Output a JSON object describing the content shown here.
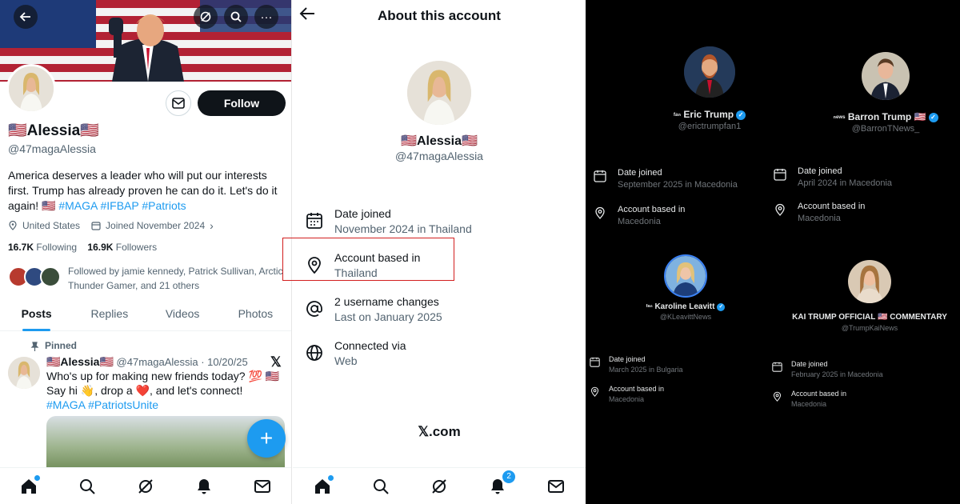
{
  "colors": {
    "accent": "#1d9bf0",
    "highlight": "#d21e1e",
    "dark_bg": "#000000"
  },
  "profile": {
    "name": "🇺🇸Alessia🇺🇸",
    "handle": "@47magaAlessia",
    "follow_label": "Follow",
    "bio_text": "America deserves a leader who will put our interests first. Trump has already proven he can do it. Let's do it again! 🇺🇸",
    "bio_tags": "#MAGA #IFBAP #Patriots",
    "location": "United States",
    "joined": "Joined November 2024",
    "following_count": "16.7K",
    "following_label": "Following",
    "followers_count": "16.9K",
    "followers_label": "Followers",
    "followed_by": "Followed by jamie kennedy, Patrick Sullivan, Arctic Thunder Gamer, and 21 others",
    "tabs": [
      "Posts",
      "Replies",
      "Videos",
      "Photos"
    ]
  },
  "pinned_post": {
    "pinned_label": "Pinned",
    "author": "🇺🇸Alessia🇺🇸",
    "handle_date": "@47magaAlessia · 10/20/25",
    "text": "Who's up for making new friends today? 💯 🇺🇸 Say hi 👋, drop a ❤️, and let's connect!",
    "tags": "#MAGA #PatriotsUnite"
  },
  "nav": {
    "icons": [
      "home-icon",
      "search-icon",
      "grok-icon",
      "notifications-icon",
      "messages-icon"
    ],
    "notification_badge": "2"
  },
  "about": {
    "title": "About this account",
    "name": "🇺🇸Alessia🇺🇸",
    "handle": "@47magaAlessia",
    "rows": [
      {
        "icon": "calendar-icon",
        "label": "Date joined",
        "value": "November 2024 in Thailand"
      },
      {
        "icon": "location-icon",
        "label": "Account based in",
        "value": "Thailand"
      },
      {
        "icon": "at-icon",
        "label": "2 username changes",
        "value": "Last on January 2025"
      },
      {
        "icon": "globe-icon",
        "label": "Connected via",
        "value": "Web"
      }
    ],
    "footer": "𝕏.com"
  },
  "accounts": [
    {
      "prefix": "ᶠᵃⁿ",
      "name": "Eric Trump",
      "flag": "",
      "verified": true,
      "handle": "@erictrumpfan1",
      "joined_label": "Date joined",
      "joined": "September 2025 in Macedonia",
      "based_label": "Account based in",
      "based": "Macedonia"
    },
    {
      "prefix": "ⁿᵉʷˢ",
      "name": "Barron Trump",
      "flag": "🇺🇸",
      "verified": true,
      "handle": "@BarronTNews_",
      "joined_label": "Date joined",
      "joined": "April 2024 in Macedonia",
      "based_label": "Account based in",
      "based": "Macedonia"
    },
    {
      "prefix": "ᶠᵃⁿ",
      "name": "Karoline Leavitt",
      "flag": "",
      "verified": true,
      "handle": "@KLeavittNews",
      "joined_label": "Date joined",
      "joined": "March 2025 in Bulgaria",
      "based_label": "Account based in",
      "based": "Macedonia"
    },
    {
      "prefix": "",
      "name": "KAI TRUMP OFFICIAL 🇺🇸 COMMENTARY",
      "flag": "",
      "verified": false,
      "handle": "@TrumpKaiNews",
      "joined_label": "Date joined",
      "joined": "February 2025 in Macedonia",
      "based_label": "Account based in",
      "based": "Macedonia"
    }
  ]
}
